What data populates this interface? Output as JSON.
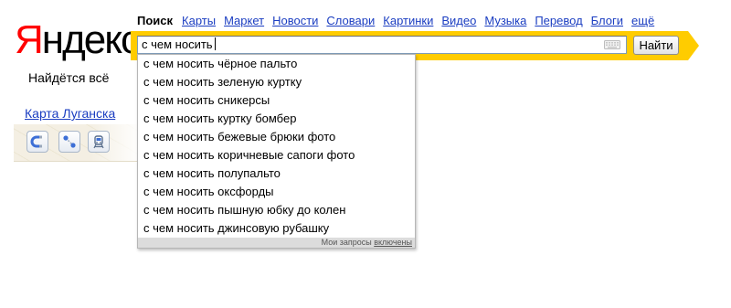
{
  "logo": {
    "first_letter": "Я",
    "rest": "ндекс"
  },
  "slogan": "Найдётся всё",
  "services": [
    {
      "label": "Поиск",
      "active": true
    },
    {
      "label": "Карты"
    },
    {
      "label": "Маркет"
    },
    {
      "label": "Новости"
    },
    {
      "label": "Словари"
    },
    {
      "label": "Картинки"
    },
    {
      "label": "Видео"
    },
    {
      "label": "Музыка"
    },
    {
      "label": "Перевод"
    },
    {
      "label": "Блоги"
    },
    {
      "label": "ещё"
    }
  ],
  "search": {
    "value": "с чем носить",
    "button_label": "Найти",
    "accent_color": "#ffcc00"
  },
  "suggest": {
    "items": [
      "с чем носить чёрное пальто",
      "с чем носить зеленую куртку",
      "с чем носить сникерсы",
      "с чем носить куртку бомбер",
      "с чем носить бежевые брюки фото",
      "с чем носить коричневые сапоги фото",
      "с чем носить полупальто",
      "с чем носить оксфорды",
      "с чем носить пышную юбку до колен",
      "с чем носить джинсовую рубашку"
    ],
    "footer_text": "Мои запросы",
    "footer_link": "включены"
  },
  "map": {
    "link_label": "Карта Луганска",
    "buttons": [
      "magnet-icon",
      "route-icon",
      "train-icon"
    ]
  },
  "colors": {
    "link": "#1a3dc1",
    "logo_red": "#ff0000"
  }
}
